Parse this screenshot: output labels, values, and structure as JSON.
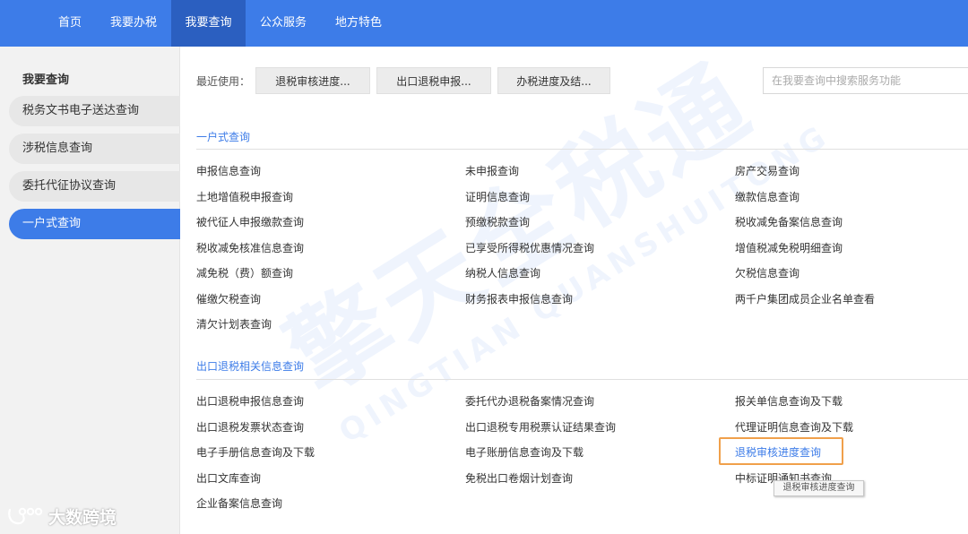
{
  "nav": {
    "items": [
      "首页",
      "我要办税",
      "我要查询",
      "公众服务",
      "地方特色"
    ],
    "active": "我要查询"
  },
  "sidebar": {
    "heading": "我要查询",
    "items": [
      "税务文书电子送达查询",
      "涉税信息查询",
      "委托代征协议查询",
      "一户式查询"
    ],
    "active": "一户式查询"
  },
  "recent": {
    "label": "最近使用：",
    "buttons": [
      "退税审核进度...",
      "出口退税申报...",
      "办税进度及结..."
    ]
  },
  "search": {
    "placeholder": "在我要查询中搜索服务功能"
  },
  "section1": {
    "title": "一户式查询",
    "rows": [
      [
        "申报信息查询",
        "未申报查询",
        "房产交易查询"
      ],
      [
        "土地增值税申报查询",
        "证明信息查询",
        "缴款信息查询"
      ],
      [
        "被代征人申报缴款查询",
        "预缴税款查询",
        "税收减免备案信息查询"
      ],
      [
        "税收减免核准信息查询",
        "已享受所得税优惠情况查询",
        "增值税减免税明细查询"
      ],
      [
        "减免税（费）额查询",
        "纳税人信息查询",
        "欠税信息查询"
      ],
      [
        "催缴欠税查询",
        "财务报表申报信息查询",
        "两千户集团成员企业名单查看"
      ],
      [
        "清欠计划表查询"
      ]
    ]
  },
  "section2": {
    "title": "出口退税相关信息查询",
    "rows": [
      [
        "出口退税申报信息查询",
        "委托代办退税备案情况查询",
        "报关单信息查询及下载"
      ],
      [
        "出口退税发票状态查询",
        "出口退税专用税票认证结果查询",
        "代理证明信息查询及下载"
      ],
      [
        "电子手册信息查询及下载",
        "电子账册信息查询及下载",
        "退税审核进度查询"
      ],
      [
        "出口文库查询",
        "免税出口卷烟计划查询",
        "中标证明通知书查询"
      ],
      [
        "企业备案信息查询"
      ]
    ],
    "highlighted": "退税审核进度查询"
  },
  "tooltip": "退税审核进度查询",
  "watermark": {
    "cn": "擎天全税通",
    "en": "QINGTIAN QUANSHUITONG"
  },
  "brand": "大数跨境",
  "colors": {
    "primary": "#3d7ce8",
    "nav_active": "#2b5fc0",
    "highlight_border": "#f0a04b"
  }
}
